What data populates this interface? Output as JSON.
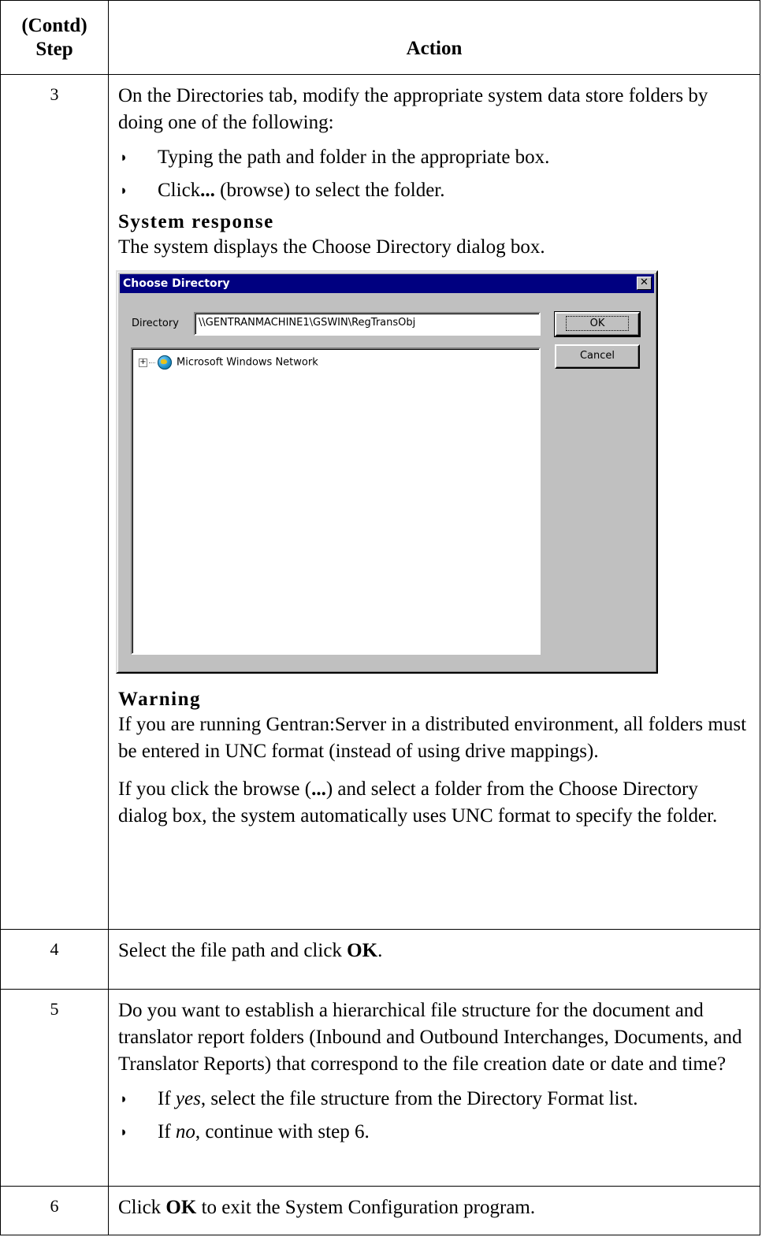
{
  "header": {
    "step_label": "(Contd)\nStep",
    "action_label": "Action"
  },
  "rows": [
    {
      "step": "3",
      "intro": "On the Directories tab, modify the appropriate system data store folders by doing one of the following:",
      "bullets": [
        "Typing the path and folder in the appropriate box.",
        "Click... (browse) to select the folder."
      ],
      "system_response_heading": "System response",
      "system_response_text": "The system displays the Choose Directory dialog box.",
      "warning_heading": "Warning",
      "warning_text": "If you are running Gentran:Server in a distributed environment, all folders must be entered in UNC format (instead of using drive mappings).",
      "browse_note": "If you click the browse (...) and select a folder from the Choose Directory dialog box, the system automatically uses UNC format to specify the folder."
    },
    {
      "step": "4",
      "text_pre": "Select the file path and click ",
      "text_bold": "OK",
      "text_post": "."
    },
    {
      "step": "5",
      "intro": "Do you want to establish a hierarchical file structure for the document and translator report folders (Inbound and Outbound Interchanges, Documents, and Translator Reports) that correspond to the file creation date or date and time?",
      "bullet_yes_pre": "If ",
      "bullet_yes_em": "yes",
      "bullet_yes_post": ", select the file structure from the Directory Format list.",
      "bullet_no_pre": "If ",
      "bullet_no_em": "no",
      "bullet_no_post": ", continue with step 6."
    },
    {
      "step": "6",
      "text_pre": "Click ",
      "text_bold": "OK",
      "text_post": " to exit the System Configuration program."
    }
  ],
  "dialog": {
    "title": "Choose Directory",
    "close_glyph": "✕",
    "directory_label": "Directory",
    "directory_value": "\\\\GENTRANMACHINE1\\GSWIN\\RegTransObj",
    "ok_label": "OK",
    "cancel_label": "Cancel",
    "tree_items": [
      {
        "label": "Microsoft Windows Network",
        "icon": "network-globe-icon",
        "expander": "+"
      }
    ]
  },
  "bullet_glyph": "◗"
}
